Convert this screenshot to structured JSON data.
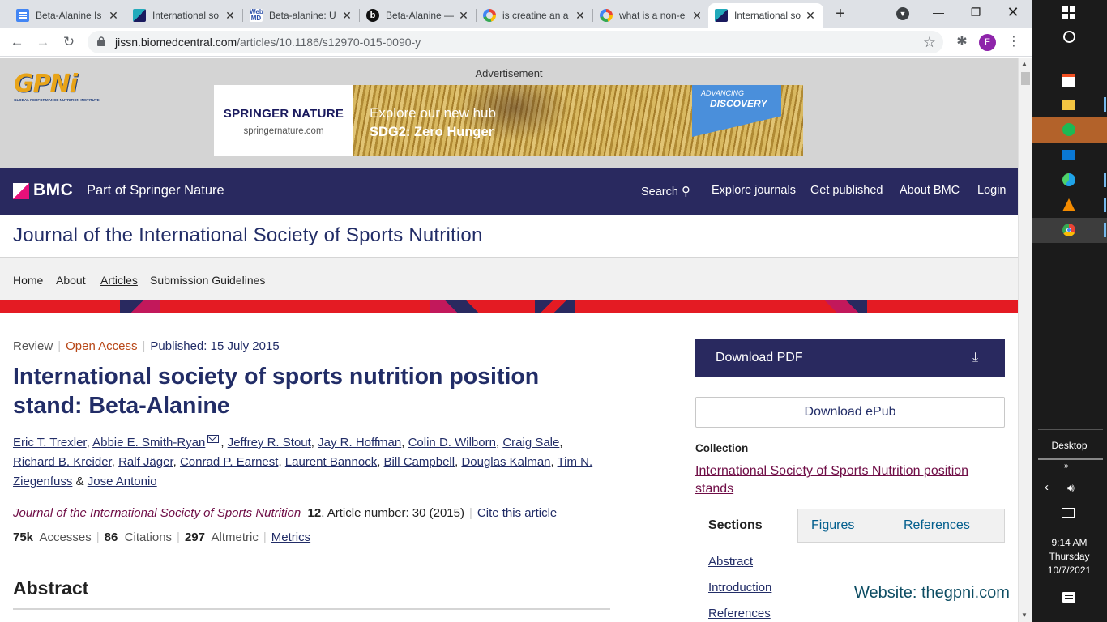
{
  "browser": {
    "tabs": [
      {
        "title": "Beta-Alanine Is",
        "fav": "#4285f4",
        "kind": "docs"
      },
      {
        "title": "International so",
        "fav": "#1a1a5e",
        "kind": "bmc"
      },
      {
        "title": "Beta-alanine: U",
        "fav": "#2b4fa8",
        "kind": "webmd"
      },
      {
        "title": "Beta-Alanine —",
        "fav": "#111111",
        "kind": "b"
      },
      {
        "title": "is creatine an a",
        "fav": "#4285f4",
        "kind": "google"
      },
      {
        "title": "what is a non-e",
        "fav": "#4285f4",
        "kind": "google"
      },
      {
        "title": "International so",
        "fav": "#1a1a5e",
        "kind": "bmc",
        "active": true
      }
    ],
    "url_host": "jissn.biomedcentral.com",
    "url_path": "/articles/10.1186/s12970-015-0090-y",
    "profile_initial": "F"
  },
  "ad": {
    "label": "Advertisement",
    "gpni_logo": "GPNi",
    "gpni_tagline": "GLOBAL PERFORMANCE NUTRITION INSTITUTE",
    "brand_a": "SPRINGER",
    "brand_b": "NATURE",
    "brand_url": "springernature.com",
    "hub_line1": "Explore our new hub",
    "hub_line2": "SDG2: Zero Hunger",
    "badge_line1": "ADVANCING",
    "badge_line2": "DISCOVERY"
  },
  "bmc": {
    "logo": "BMC",
    "tagline": "Part of Springer Nature",
    "nav": [
      "Search",
      "Explore journals",
      "Get published",
      "About BMC",
      "Login"
    ]
  },
  "journal_title": "Journal of the International Society of Sports Nutrition",
  "subnav": [
    "Home",
    "About",
    "Articles",
    "Submission Guidelines"
  ],
  "article": {
    "type": "Review",
    "access": "Open Access",
    "published": "Published: 15 July 2015",
    "title": "International society of sports nutrition position stand: Beta-Alanine",
    "authors_line1": [
      "Eric T. Trexler",
      "Abbie E. Smith-Ryan",
      "Jeffrey R. Stout",
      "Jay R. Hoffman",
      "Colin D. Wilborn",
      "Craig Sale"
    ],
    "authors_line2": [
      "Richard B. Kreider",
      "Ralf Jäger",
      "Conrad P. Earnest",
      "Laurent Bannock",
      "Bill Campbell",
      "Douglas Kalman",
      "Tim N."
    ],
    "author_last_part": "Ziegenfuss",
    "and": "&",
    "author_final": "Jose Antonio",
    "journal": "Journal of the International Society of Sports Nutrition",
    "volume": "12",
    "article_number": ", Article number: 30 (2015)",
    "cite": "Cite this article",
    "metrics": [
      {
        "value": "75k",
        "label": "Accesses"
      },
      {
        "value": "86",
        "label": "Citations"
      },
      {
        "value": "297",
        "label": "Altmetric"
      }
    ],
    "metrics_link": "Metrics",
    "abstract_heading": "Abstract"
  },
  "sidebar": {
    "download_pdf": "Download PDF",
    "download_epub": "Download ePub",
    "collection_label": "Collection",
    "collection_link": "International Society of Sports Nutrition position stands",
    "tabs": [
      "Sections",
      "Figures",
      "References"
    ],
    "sections": [
      "Abstract",
      "Introduction",
      "References"
    ]
  },
  "watermark": "Website: thegpni.com",
  "taskbar": {
    "desktop": "Desktop",
    "time": "9:14 AM",
    "day": "Thursday",
    "date": "10/7/2021"
  },
  "colors": {
    "navy": "#29295f",
    "red": "#e41b23",
    "open_access": "#b74616",
    "link": "#025e8d"
  }
}
